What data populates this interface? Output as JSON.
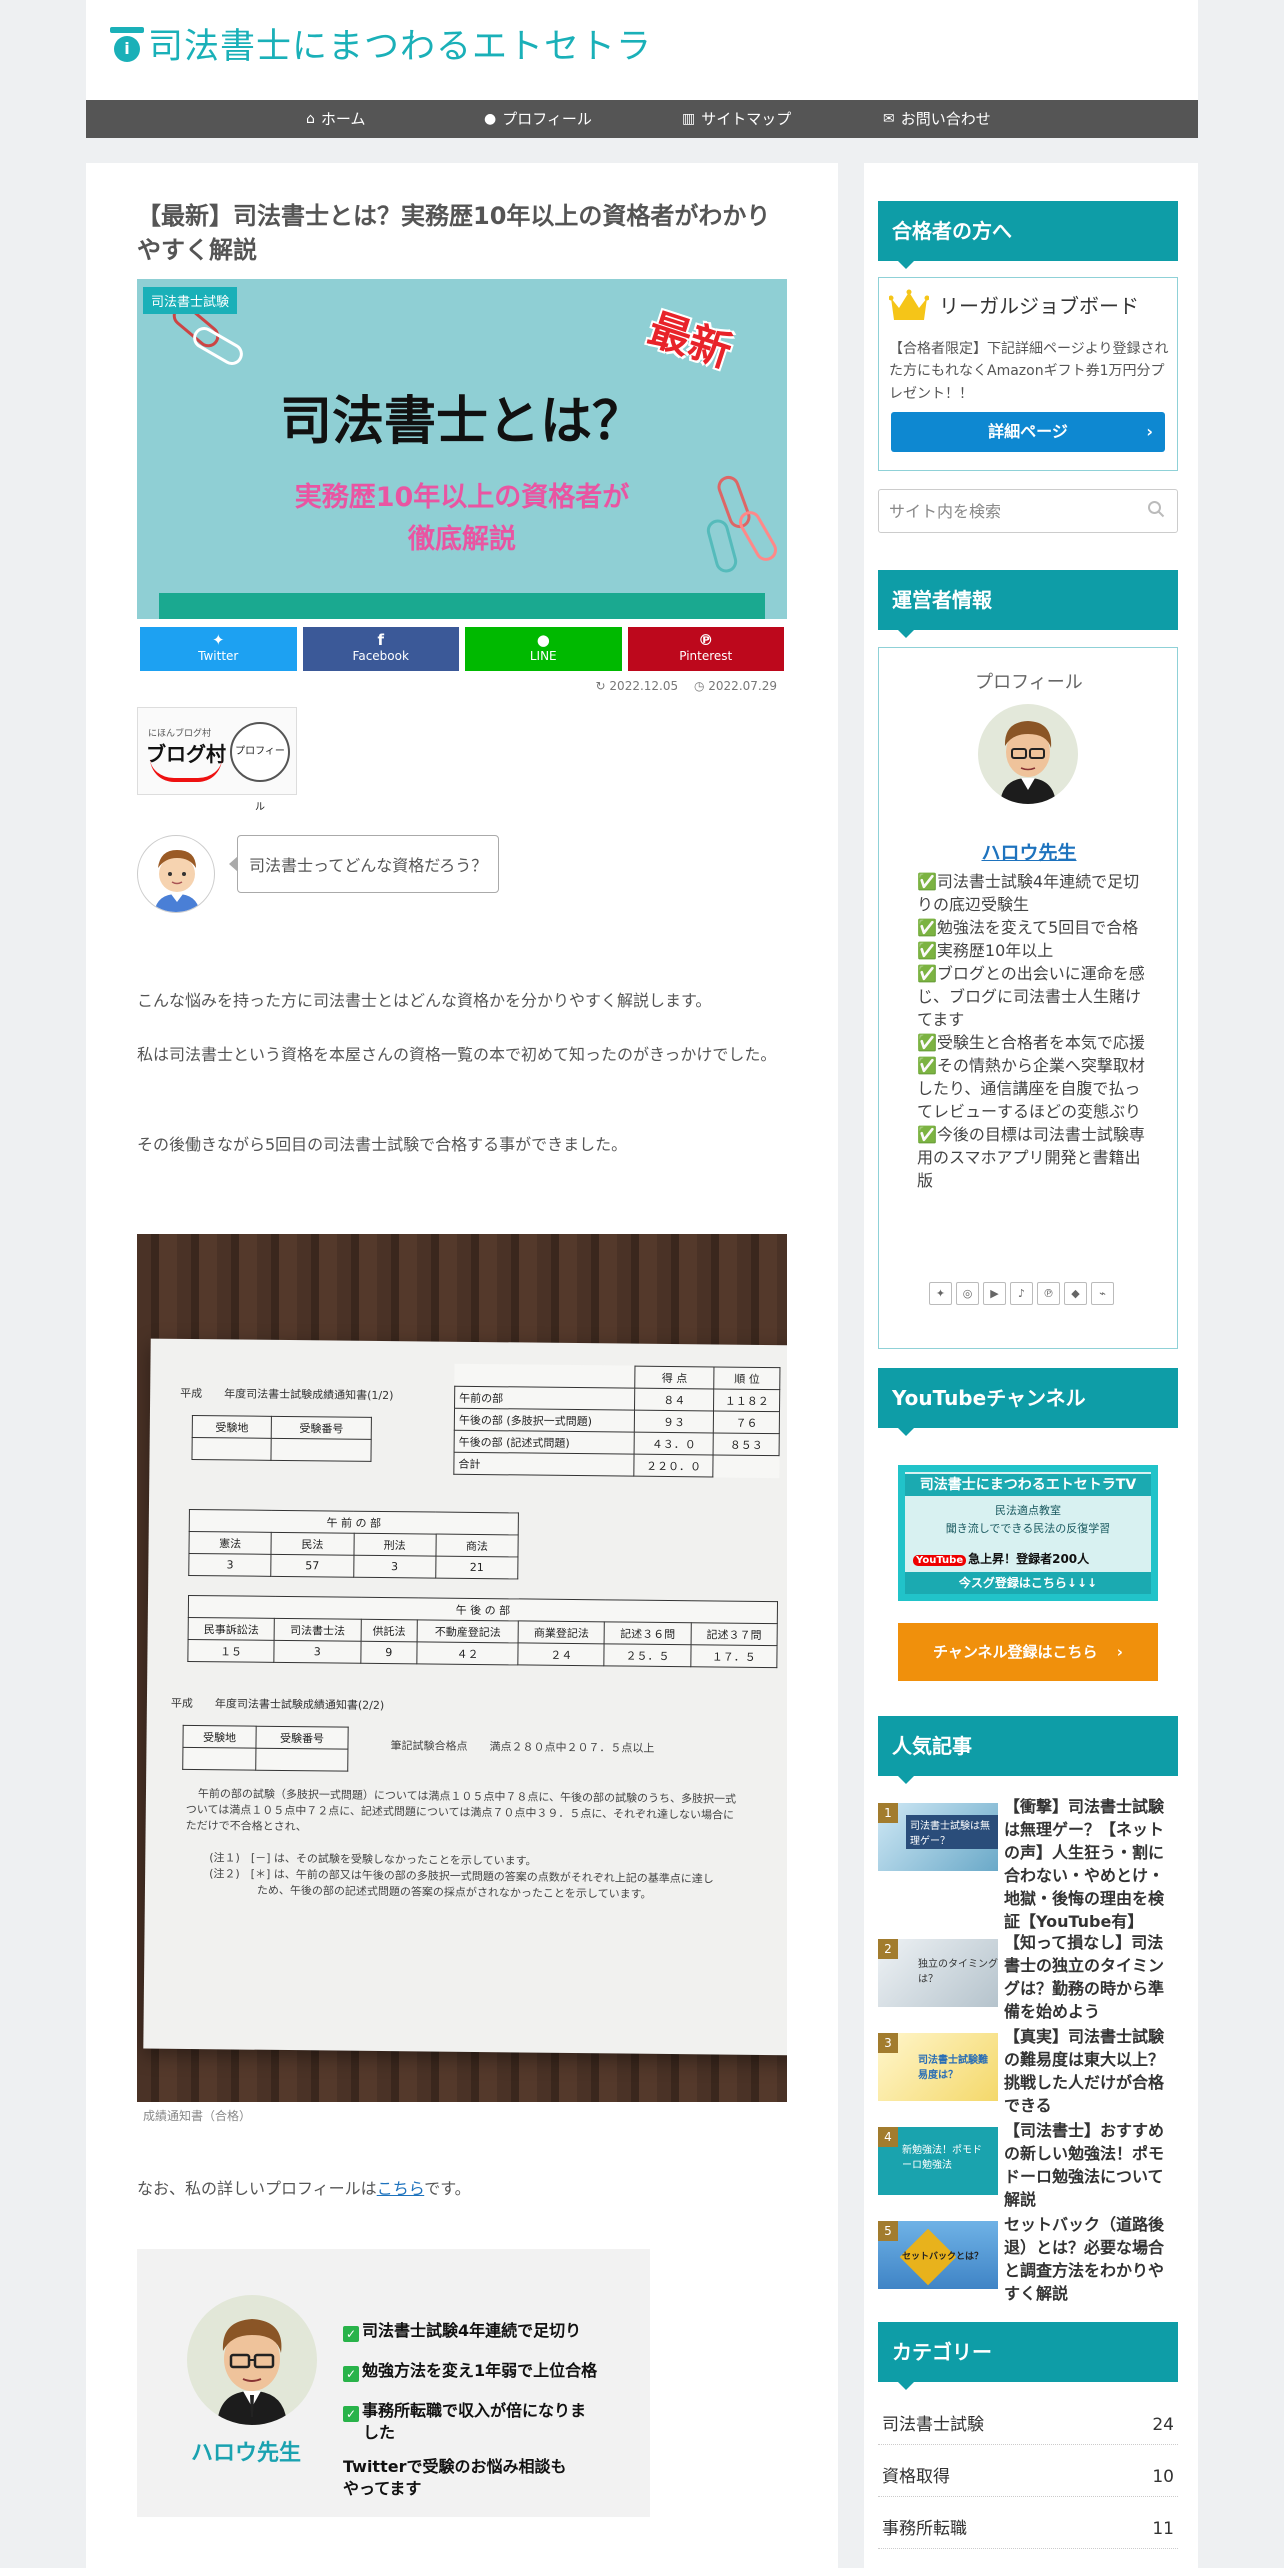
{
  "site": {
    "title": "司法書士にまつわるエトセトラ"
  },
  "nav": [
    {
      "label": "ホーム",
      "icon": "home-icon"
    },
    {
      "label": "プロフィール",
      "icon": "user-icon"
    },
    {
      "label": "サイトマップ",
      "icon": "map-icon"
    },
    {
      "label": "お問い合わせ",
      "icon": "envelope-icon"
    }
  ],
  "article": {
    "title": "【最新】司法書士とは？実務歴10年以上の資格者がわかりやすく解説",
    "category": "司法書士試験",
    "eyecatch": {
      "badge": "最新",
      "main": "司法書士とは？",
      "sub1": "実務歴10年以上の資格者が",
      "sub2": "徹底解説"
    },
    "share": {
      "twitter": "Twitter",
      "facebook": "Facebook",
      "line": "LINE",
      "pinterest": "Pinterest"
    },
    "updated": "2022.12.05",
    "published": "2022.07.29",
    "blog_village": {
      "small": "にほんブログ村",
      "main": "ブログ村",
      "circle": "プロフィール"
    },
    "speech": "司法書士ってどんな資格だろう？",
    "paragraphs": [
      "こんな悩みを持った方に司法書士とはどんな資格かを分かりやすく解説します。",
      "私は司法書士という資格を本屋さんの資格一覧の本で初めて知ったのがきっかけでした。",
      "その後働きながら5回目の司法書士試験で合格する事ができました。"
    ],
    "photo_caption": "成績通知書（合格）",
    "profile_prefix": "なお、私の詳しいプロフィールは",
    "profile_link": "こちら",
    "profile_suffix": "です。",
    "banner": {
      "name": "ハロウ先生",
      "lines": [
        "司法書士試験4年連続で足切り",
        "勉強方法を変え1年弱で上位合格",
        "事務所転職で収入が倍になりま",
        "した",
        "Twitterで受験のお悩み相談も",
        "やってます"
      ]
    }
  },
  "score_sheet": {
    "title1": "平成　　年度司法書士試験成績通知書(1/2)",
    "title2": "平成　　年度司法書士試験成績通知書(2/2)",
    "id_headers": [
      "受験地",
      "受験番号"
    ],
    "score_headers": [
      "得 点",
      "順 位"
    ],
    "score_rows": [
      {
        "label": "午前の部",
        "score": "８４",
        "rank": "１１８２"
      },
      {
        "label": "午後の部 (多肢択一式問題)",
        "score": "９３",
        "rank": "７６"
      },
      {
        "label": "午後の部 (記述式問題)",
        "score": "４３．０",
        "rank": "８５３"
      },
      {
        "label": "合計",
        "score": "２２０．０",
        "rank": ""
      }
    ],
    "am_title": "午 前 の 部",
    "am_headers": [
      "憲法",
      "民法",
      "刑法",
      "商法"
    ],
    "am_values": [
      "3",
      "57",
      "3",
      "21"
    ],
    "pm_title": "午 後 の 部",
    "pm_headers": [
      "民事訴訟法",
      "司法書士法",
      "供託法",
      "不動産登記法",
      "商業登記法",
      "記述３６問",
      "記述３７問"
    ],
    "pm_values": [
      "１５",
      "3",
      "9",
      "４２",
      "２４",
      "２５．５",
      "１７．５"
    ],
    "pass_line": "筆記試験合格点　　満点２８０点中２０７．５点以上",
    "note1": "午前の部の試験（多肢択一式問題）については満点１０５点中７８点に、午後の部の試験のうち、多肢択一式",
    "note2": "ついては満点１０５点中７２点に、記述式問題については満点７０点中３９．５点に、それぞれ達しない場合に",
    "note3": "ただけで不合格とされ、",
    "note4": "(注１)　[－] は、その試験を受験しなかったことを示しています。",
    "note5": "(注２)　[＊] は、午前の部又は午後の部の多肢択一式問題の答案の点数がそれぞれ上記の基準点に達し",
    "note6": "ため、午後の部の記述式問題の答案の採点がされなかったことを示しています。"
  },
  "sidebar": {
    "passers_heading": "合格者の方へ",
    "legal_job": {
      "title": "リーガルジョブボード",
      "text": "【合格者限定】下記詳細ページより登録された方にもれなくAmazonギフト券1万円分プレゼント！！",
      "button": "詳細ページ"
    },
    "search_placeholder": "サイト内を検索",
    "operator_heading": "運営者情報",
    "operator": {
      "label": "プロフィール",
      "name": "ハロウ先生",
      "bio": [
        "✅司法書士試験4年連続で足切りの底辺受験生",
        "✅勉強法を変えて5回目で合格",
        "✅実務歴10年以上",
        "✅ブログとの出会いに運命を感じ、ブログに司法書士人生賭けてます",
        "✅受験生と合格者を本気で応援",
        "✅その情熱から企業へ突撃取材したり、通信講座を自腹で払ってレビューするほどの変態ぶり",
        "✅今後の目標は司法書士試験専用のスマホアプリ開発と書籍出版"
      ]
    },
    "youtube_heading": "YouTubeチャンネル",
    "youtube_banner": {
      "t1": "司法書士にまつわるエトセトラTV",
      "t2": "民法適点教室",
      "t3": "聞き流しでできる民法の反復学習",
      "t4": "急上昇！登録者200人",
      "t5": "今スグ登録はこちら↓↓↓",
      "logo": "YouTube"
    },
    "youtube_button": "チャンネル登録はこちら",
    "popular_heading": "人気記事",
    "popular": [
      {
        "num": "1",
        "title": "【衝撃】司法書士試験は無理ゲー？【ネットの声】人生狂う・割に合わない・やめとけ・地獄・後悔の理由を検証【YouTube有】",
        "thumb": "司法書士試験は無理ゲー？"
      },
      {
        "num": "2",
        "title": "【知って損なし】司法書士の独立のタイミングは？勤務の時から準備を始めよう",
        "thumb": "独立のタイミングは？"
      },
      {
        "num": "3",
        "title": "【真実】司法書士試験の難易度は東大以上？挑戦した人だけが合格できる",
        "thumb": "司法書士試験難易度は？"
      },
      {
        "num": "4",
        "title": "【司法書士】おすすめの新しい勉強法！ポモドーロ勉強法について解説",
        "thumb": "新勉強法！ポモドーロ勉強法"
      },
      {
        "num": "5",
        "title": "セットバック（道路後退）とは？必要な場合と調査方法をわかりやすく解説",
        "thumb": "セットバックとは？"
      }
    ],
    "category_heading": "カテゴリー",
    "categories": [
      {
        "name": "司法書士試験",
        "count": "24"
      },
      {
        "name": "資格取得",
        "count": "10"
      },
      {
        "name": "事務所転職",
        "count": "11"
      }
    ]
  },
  "colors": {
    "accent": "#0e9da7",
    "logo": "#1ab0b8",
    "nav": "#555555",
    "link": "#1e73be",
    "twitter": "#1da1f2",
    "facebook": "#3b5998",
    "line": "#00b900",
    "pinterest": "#bd081c"
  }
}
